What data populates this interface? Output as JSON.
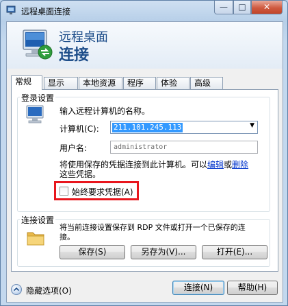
{
  "window": {
    "title": "远程桌面连接",
    "minimize_glyph": "—",
    "maximize_glyph": "□",
    "close_glyph": "✕"
  },
  "banner": {
    "line1": "远程桌面",
    "line2": "连接"
  },
  "tabs": [
    {
      "label": "常规",
      "active": true
    },
    {
      "label": "显示",
      "active": false
    },
    {
      "label": "本地资源",
      "active": false
    },
    {
      "label": "程序",
      "active": false
    },
    {
      "label": "体验",
      "active": false
    },
    {
      "label": "高级",
      "active": false
    }
  ],
  "login": {
    "group_label": "登录设置",
    "prompt": "输入远程计算机的名称。",
    "computer_label": "计算机(C):",
    "computer_value": "211.101.245.113",
    "username_label": "用户名:",
    "username_value": "administrator",
    "saved_text_prefix": "将使用保存的凭据连接到此计算机。可以",
    "edit_link": "编辑",
    "saved_text_or": "或",
    "delete_link": "删除",
    "saved_text_line2": "这些凭据。",
    "always_ask_label": "始终要求凭据(A)",
    "always_ask_checked": false
  },
  "connection": {
    "group_label": "连接设置",
    "description_line1": "将当前连接设置保存到 RDP 文件或打开一个已保存的连",
    "description_line2": "接。",
    "save_button": "保存(S)",
    "save_as_button": "另存为(V)...",
    "open_button": "打开(E)..."
  },
  "footer": {
    "hide_options": "隐藏选项(O)",
    "connect_button": "连接(N)",
    "help_button": "帮助(H)"
  },
  "colors": {
    "highlight_box": "#e8161d",
    "link": "#0033cc",
    "selection": "#3399ff"
  }
}
